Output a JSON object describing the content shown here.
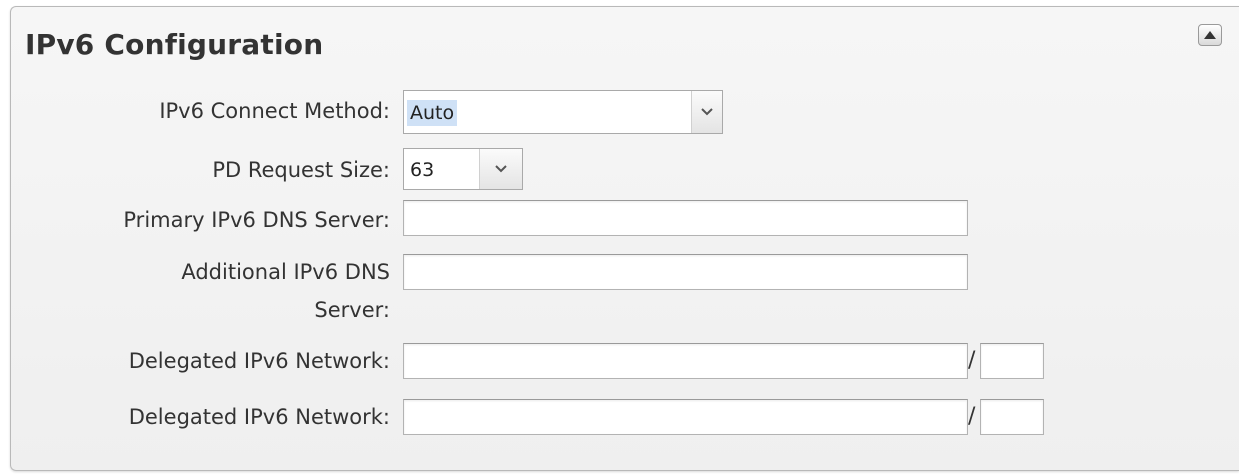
{
  "section": {
    "title": "IPv6 Configuration",
    "collapse_icon": "collapse-up-icon"
  },
  "fields": {
    "connect_method": {
      "label": "IPv6 Connect Method:",
      "value": "Auto",
      "icon": "chevron-down-icon"
    },
    "pd_request_size": {
      "label": "PD Request Size:",
      "value": "63",
      "icon": "chevron-down-icon"
    },
    "primary_dns": {
      "label": "Primary IPv6 DNS Server:",
      "value": "",
      "placeholder": ""
    },
    "additional_dns": {
      "label_line1": "Additional IPv6 DNS",
      "label_line2": "Server:",
      "value": "",
      "placeholder": ""
    },
    "delegated_network_1": {
      "label": "Delegated IPv6 Network:",
      "value": "",
      "separator": "/",
      "prefix_value": ""
    },
    "delegated_network_2": {
      "label": "Delegated IPv6 Network:",
      "value": "",
      "separator": "/",
      "prefix_value": ""
    }
  },
  "colors": {
    "selection_highlight": "#cfe1f6",
    "panel_background": "#f2f2f2",
    "text": "#333333"
  }
}
